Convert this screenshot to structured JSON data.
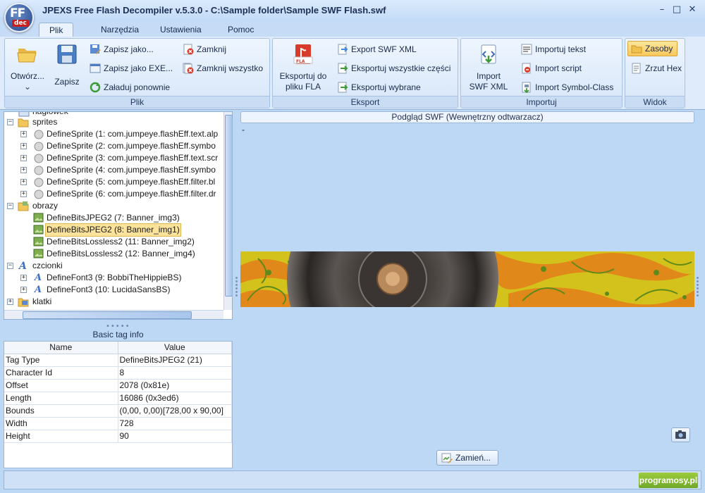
{
  "window": {
    "logo_main": "FF",
    "logo_sub": "dec",
    "title": "JPEXS Free Flash Decompiler v.5.3.0 - C:\\Sample folder\\Sample SWF Flash.swf",
    "minimize": "–",
    "maximize": "□",
    "close": "✕"
  },
  "menu_tabs": [
    "Plik",
    "Narzędzia",
    "Ustawienia",
    "Pomoc"
  ],
  "ribbon": {
    "plik": {
      "caption": "Plik",
      "open_label": "Otwórz...",
      "open_arrow": "⌄",
      "save_label": "Zapisz",
      "save_as": "Zapisz jako...",
      "save_exe": "Zapisz jako EXE...",
      "reload": "Załaduj ponownie",
      "close": "Zamknij",
      "close_all": "Zamknij wszystko"
    },
    "eksport": {
      "caption": "Eksport",
      "fla_badge": "FLA",
      "export_fla_line1": "Eksportuj do",
      "export_fla_line2": "pliku FLA",
      "export_xml": "Export SWF XML",
      "export_all": "Eksportuj wszystkie części",
      "export_selected": "Eksportuj wybrane"
    },
    "importuj": {
      "caption": "Importuj",
      "import_xml_line1": "Import",
      "import_xml_line2": "SWF XML",
      "import_text": "Importuj tekst",
      "import_script": "Import script",
      "import_symbol": "Import Symbol-Class"
    },
    "widok": {
      "caption": "Widok",
      "resources": "Zasoby",
      "hexdump": "Zrzut Hex"
    }
  },
  "tree": {
    "header_partial": "nagłówek",
    "sprites": "sprites",
    "sprite_items": [
      "DefineSprite (1: com.jumpeye.flashEff.text.alp",
      "DefineSprite (2: com.jumpeye.flashEff.symbo",
      "DefineSprite (3: com.jumpeye.flashEff.text.scr",
      "DefineSprite (4: com.jumpeye.flashEff.symbo",
      "DefineSprite (5: com.jumpeye.flashEff.filter.bl",
      "DefineSprite (6: com.jumpeye.flashEff.filter.dr"
    ],
    "images": "obrazy",
    "image_items": [
      "DefineBitsJPEG2 (7: Banner_img3)",
      "DefineBitsJPEG2 (8: Banner_img1)",
      "DefineBitsLossless2 (11: Banner_img2)",
      "DefineBitsLossless2 (12: Banner_img4)"
    ],
    "fonts": "czcionki",
    "font_items": [
      "DefineFont3 (9: BobbiTheHippieBS)",
      "DefineFont3 (10: LucidaSansBS)"
    ],
    "frames": "klatki",
    "font_glyph": "A",
    "plus": "+",
    "minus": "−"
  },
  "info": {
    "grip": "•••••",
    "title": "Basic tag info",
    "col_name": "Name",
    "col_value": "Value",
    "rows": [
      {
        "name": "Tag Type",
        "value": "DefineBitsJPEG2 (21)"
      },
      {
        "name": "Character Id",
        "value": "8"
      },
      {
        "name": "Offset",
        "value": "2078 (0x81e)"
      },
      {
        "name": "Length",
        "value": "16086 (0x3ed6)"
      },
      {
        "name": "Bounds",
        "value": "(0,00, 0,00)[728,00 x 90,00]"
      },
      {
        "name": "Width",
        "value": "728"
      },
      {
        "name": "Height",
        "value": "90"
      }
    ]
  },
  "preview": {
    "header": "Podgląd SWF (Wewnętrzny odtwarzacz)",
    "dash": "-",
    "replace": "Zamień..."
  },
  "status": {
    "brand": "programosy.pl"
  },
  "colors": {
    "accent": "#d93b2a",
    "selection": "#fbe39b",
    "banner_yellow": "#d4c21c",
    "banner_orange": "#e0891a",
    "banner_green": "#5f8a1a"
  }
}
